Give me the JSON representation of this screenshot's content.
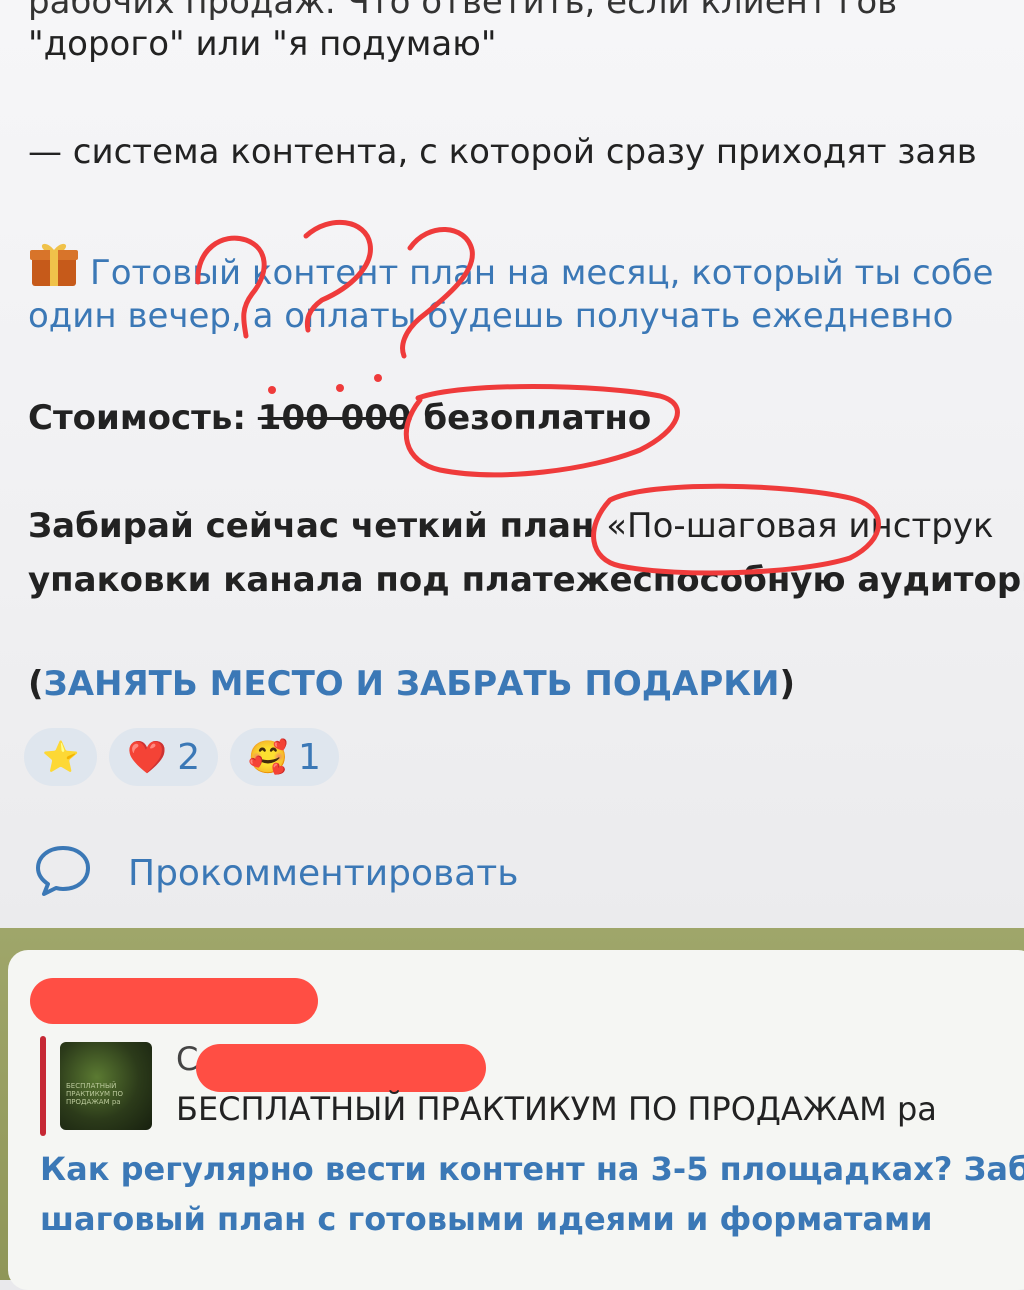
{
  "post": {
    "line_1_partial": "рабочих продаж. Что ответить, если клиент гов",
    "line_2": "\"дорого\" или \"я подумаю\"",
    "system_line": "— система контента, с которой сразу приходят заяв",
    "gift_line_1": "Готовый контент план на месяц, который ты собе",
    "gift_line_2": "один вечер, а оплаты будешь получать ежедневно",
    "cost_label": "Стоимость:",
    "cost_old": "100 000",
    "cost_new": "безоплатно",
    "cta_line_1_prefix": "Забирай сейчас четкий план ",
    "cta_line_1_quote": "«По-шаговая инструк",
    "cta_line_2": "упаковки канала под платежеспособную аудитори",
    "link_open": "(",
    "link_text": "ЗАНЯТЬ МЕСТО И ЗАБРАТЬ ПОДАРКИ",
    "link_close": ")"
  },
  "reactions": [
    {
      "icon": "star-icon",
      "emoji": "⭐",
      "count": ""
    },
    {
      "icon": "heart-icon",
      "emoji": "❤️",
      "count": "2"
    },
    {
      "icon": "hugging-face-icon",
      "emoji": "🥰",
      "count": "1"
    }
  ],
  "comment": {
    "label": "Прокомментировать",
    "icon": "comment-bubble-icon"
  },
  "reply": {
    "title": "БЕСПЛАТНЫЙ ПРАКТИКУМ ПО ПРОДАЖАМ  ра",
    "name_partial": "С",
    "body_line_1": "Как регулярно вести контент на 3-5 площадках? Заб",
    "body_line_2": "шаговый план с готовыми идеями и форматами"
  },
  "annotations": {
    "question_marks": "???"
  },
  "colors": {
    "link": "#3b78b6",
    "annotation": "#ef3b3b",
    "chat_bg": "#9fa66a"
  }
}
